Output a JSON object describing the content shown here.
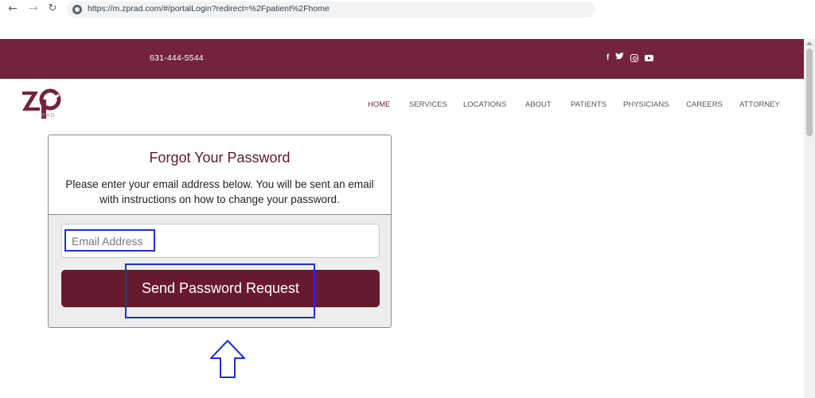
{
  "browser": {
    "url": "https://m.zprad.com/#/portalLogin?redirect=%2Fpatient%2Fhome"
  },
  "topbar": {
    "phone": "631-444-5544",
    "social_icons": [
      "facebook-icon",
      "twitter-icon",
      "instagram-icon",
      "youtube-icon"
    ],
    "background_color": "#74233c"
  },
  "logo": {
    "sub_text": "RAD"
  },
  "nav": {
    "items": [
      {
        "label": "HOME"
      },
      {
        "label": "SERVICES"
      },
      {
        "label": "LOCATIONS"
      },
      {
        "label": "ABOUT"
      },
      {
        "label": "PATIENTS"
      },
      {
        "label": "PHYSICIANS"
      },
      {
        "label": "CAREERS"
      },
      {
        "label": "ATTORNEY"
      }
    ],
    "active_label": "HOME",
    "active_color": "#74233c"
  },
  "form": {
    "title": "Forgot Your Password",
    "description": "Please enter your email address below. You will be sent an email with instructions on how to change your password.",
    "email_placeholder": "Email Address",
    "email_value": "",
    "submit_label": "Send Password Request",
    "button_color": "#671a2e"
  },
  "annotations": {
    "highlight_color": "#1f2fd6"
  }
}
